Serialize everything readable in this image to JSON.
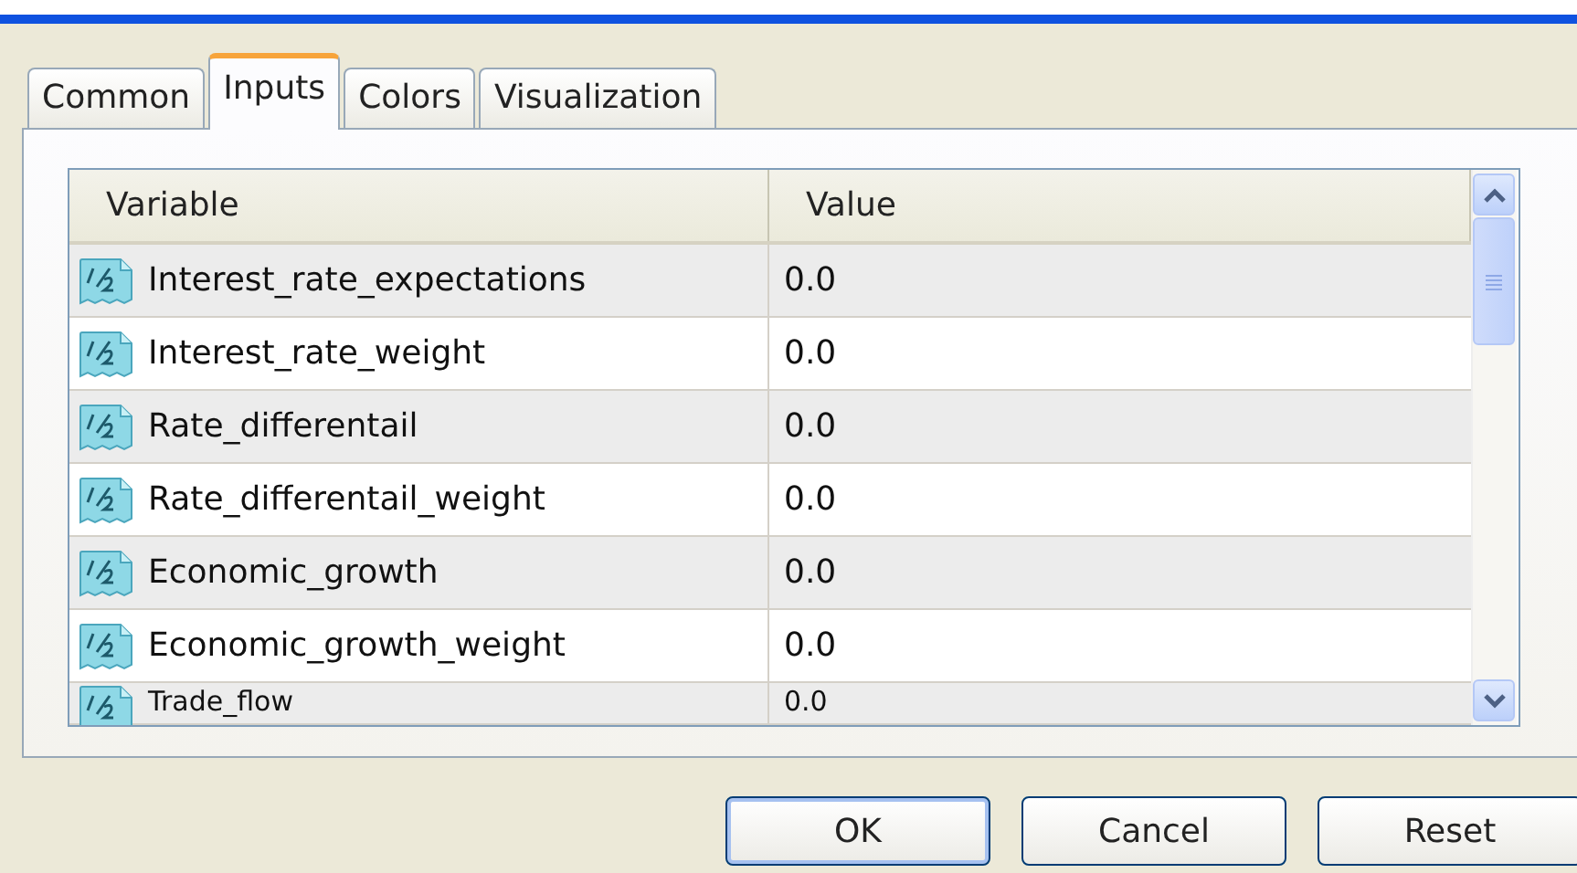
{
  "tabs": [
    {
      "label": "Common",
      "selected": false
    },
    {
      "label": "Inputs",
      "selected": true
    },
    {
      "label": "Colors",
      "selected": false
    },
    {
      "label": "Visualization",
      "selected": false
    }
  ],
  "table": {
    "columns": [
      "Variable",
      "Value"
    ],
    "rows": [
      {
        "variable": "Interest_rate_expectations",
        "value": "0.0"
      },
      {
        "variable": "Interest_rate_weight",
        "value": "0.0"
      },
      {
        "variable": "Rate_differentail",
        "value": "0.0"
      },
      {
        "variable": "Rate_differentail_weight",
        "value": "0.0"
      },
      {
        "variable": "Economic_growth",
        "value": "0.0"
      },
      {
        "variable": "Economic_growth_weight",
        "value": "0.0"
      },
      {
        "variable": "Trade_flow",
        "value": "0.0"
      }
    ]
  },
  "buttons": [
    "OK",
    "Cancel",
    "Reset"
  ]
}
